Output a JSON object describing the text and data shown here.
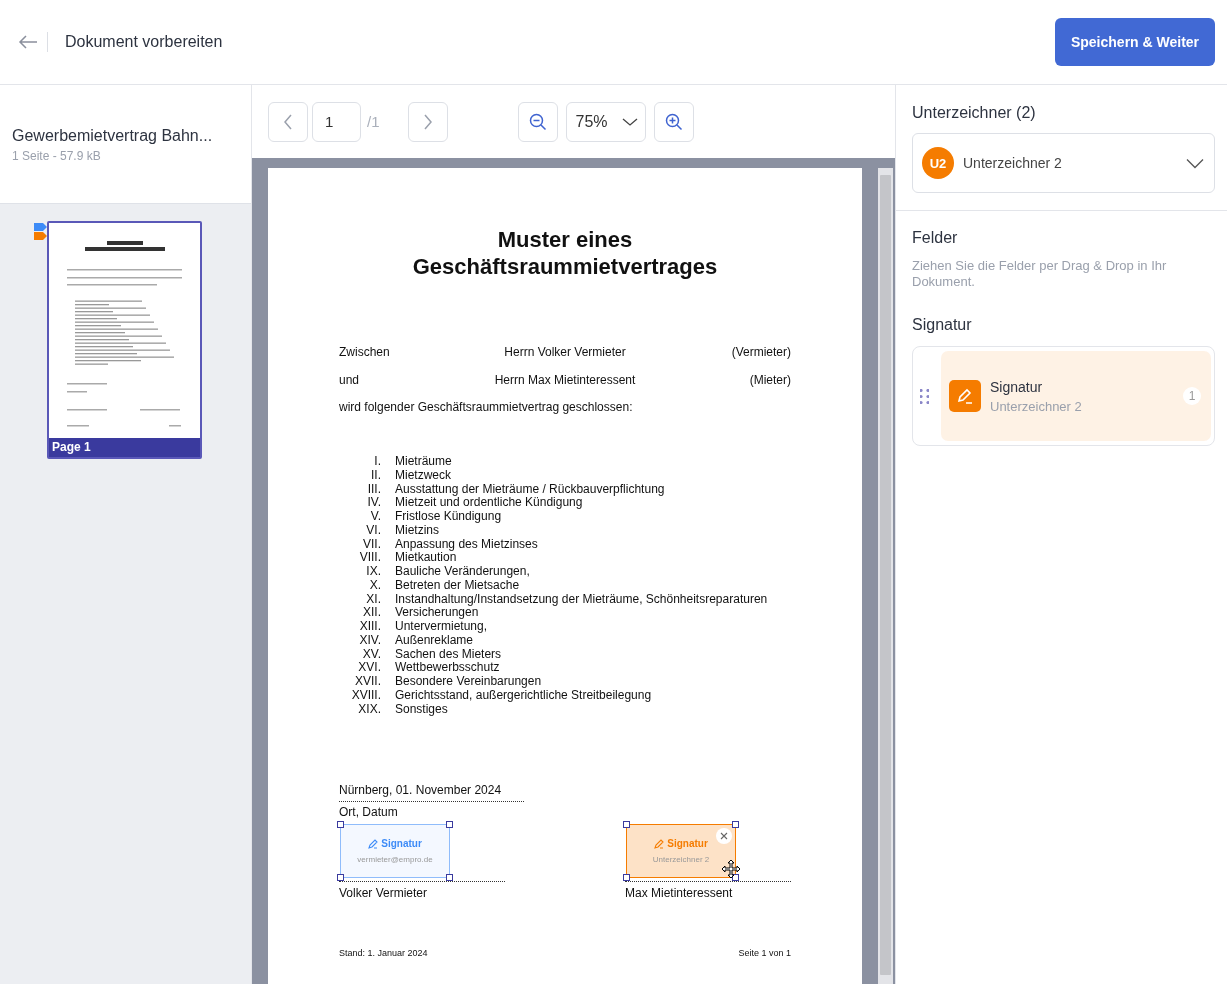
{
  "header": {
    "title": "Dokument vorbereiten",
    "primary_button": "Speichern & Weiter"
  },
  "document_card": {
    "name": "Gewerbemietvertrag Bahn...",
    "meta": "1 Seite - 57.9 kB"
  },
  "thumbnails": [
    {
      "label": "Page 1",
      "selected": true,
      "markers": [
        {
          "color": "#3d8bf7"
        },
        {
          "color": "#f57c00"
        }
      ]
    }
  ],
  "toolbar": {
    "page": "1",
    "page_total": "/1",
    "zoom": "75%"
  },
  "document": {
    "title": [
      "Muster eines",
      "Geschäftsraummietvertrages"
    ],
    "parties": [
      {
        "label": "Zwischen",
        "name": "Herrn Volker Vermieter",
        "role": "(Vermieter)"
      },
      {
        "label": "und",
        "name": "Herrn Max Mietinteressent",
        "role": "(Mieter)"
      }
    ],
    "intro": "wird folgender Geschäftsraummietvertrag geschlossen:",
    "clauses": [
      {
        "num": "I.",
        "text": "Mieträume"
      },
      {
        "num": "II.",
        "text": "Mietzweck"
      },
      {
        "num": "III.",
        "text": "Ausstattung der Mieträume / Rückbauverpflichtung"
      },
      {
        "num": "IV.",
        "text": "Mietzeit und ordentliche Kündigung"
      },
      {
        "num": "V.",
        "text": "Fristlose Kündigung"
      },
      {
        "num": "VI.",
        "text": "Mietzins"
      },
      {
        "num": "VII.",
        "text": "Anpassung des Mietzinses"
      },
      {
        "num": "VIII.",
        "text": "Mietkaution"
      },
      {
        "num": "IX.",
        "text": "Bauliche Veränderungen,"
      },
      {
        "num": "X.",
        "text": "Betreten der Mietsache"
      },
      {
        "num": "XI.",
        "text": "Instandhaltung/Instandsetzung der Mieträume, Schönheitsreparaturen"
      },
      {
        "num": "XII.",
        "text": "Versicherungen"
      },
      {
        "num": "XIII.",
        "text": "Untervermietung,"
      },
      {
        "num": "XIV.",
        "text": "Außenreklame"
      },
      {
        "num": "XV.",
        "text": "Sachen des Mieters"
      },
      {
        "num": "XVI.",
        "text": "Wettbewerbsschutz"
      },
      {
        "num": "XVII.",
        "text": "Besondere Vereinbarungen"
      },
      {
        "num": "XVIII.",
        "text": "Gerichtsstand, außergerichtliche Streitbeilegung"
      },
      {
        "num": "XIX.",
        "text": "Sonstiges"
      }
    ],
    "place_date": "Nürnberg, 01. November 2024",
    "place_label": "Ort, Datum",
    "signatures": [
      {
        "name": "Volker Vermieter",
        "field": {
          "label": "Signatur",
          "sub": "vermieter@empro.de",
          "color": "#3d8bf7",
          "selected": false
        }
      },
      {
        "name": "Max Mietinteressent",
        "field": {
          "label": "Signatur",
          "sub": "Unterzeichner 2",
          "color": "#f57c00",
          "selected": true
        }
      }
    ],
    "footer_left": "Stand: 1. Januar 2024",
    "footer_right": "Seite 1 von 1"
  },
  "sidebar": {
    "signers_title": "Unterzeichner (2)",
    "signer": {
      "initials": "U2",
      "name": "Unterzeichner 2",
      "color": "#f57c00"
    },
    "fields_title": "Felder",
    "fields_hint": "Ziehen Sie die Felder per Drag & Drop in Ihr Dokument.",
    "section": "Signatur",
    "items": [
      {
        "label": "Signatur",
        "sub": "Unterzeichner 2",
        "count": "1",
        "color": "#f57c00"
      }
    ]
  }
}
